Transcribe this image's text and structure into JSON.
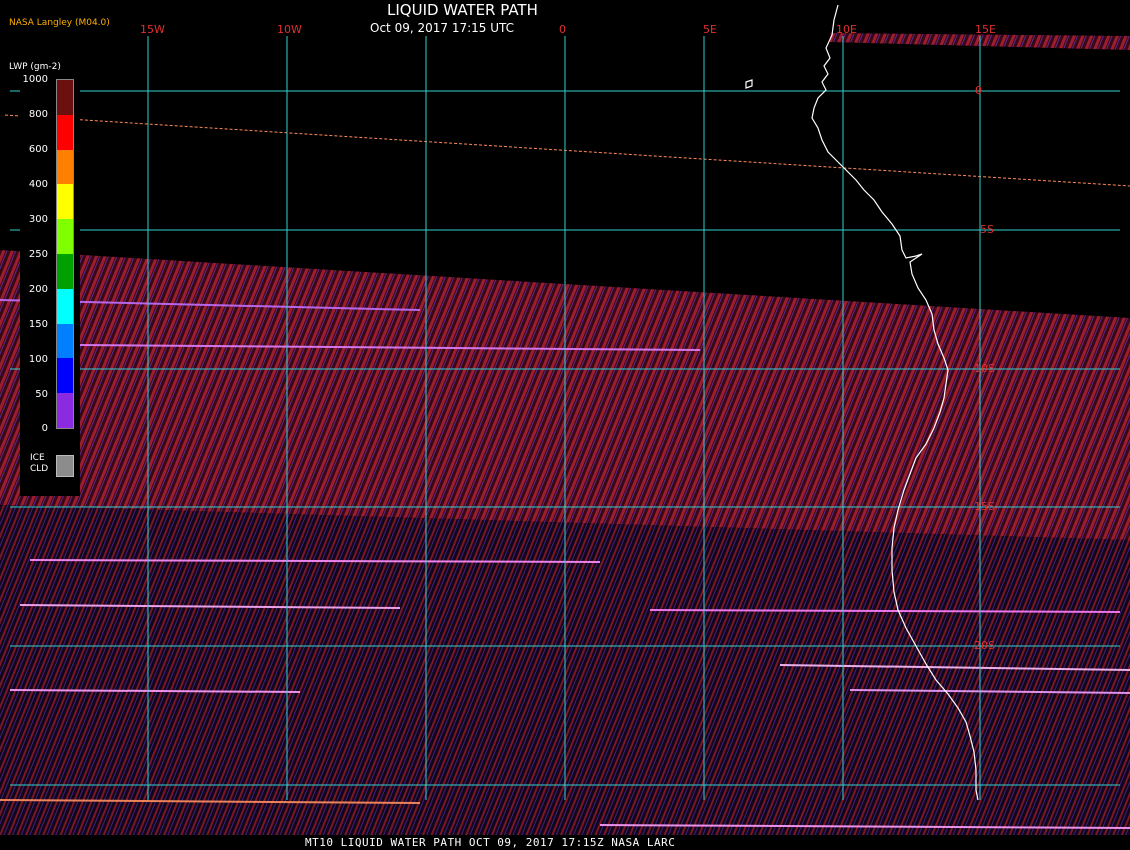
{
  "header": {
    "title": "LIQUID WATER PATH",
    "subtitle": "Oct 09, 2017 17:15 UTC",
    "source": "NASA Langley (M04.0)"
  },
  "longitude_labels": [
    "15W",
    "10W",
    "0",
    "5E",
    "10E",
    "15E"
  ],
  "latitude_labels": [
    "0",
    "5S",
    "10S",
    "15S",
    "20S"
  ],
  "legend": {
    "title": "LWP (gm-2)",
    "ticks": [
      "1000",
      "800",
      "600",
      "400",
      "300",
      "250",
      "200",
      "150",
      "100",
      "50",
      "0"
    ],
    "colors": [
      "#6b0f0f",
      "#ff0000",
      "#ff8000",
      "#ffff00",
      "#80ff00",
      "#00a000",
      "#00ffff",
      "#0080ff",
      "#0000ff",
      "#8a2be2"
    ],
    "ice_label_line1": "ICE",
    "ice_label_line2": "CLD",
    "ice_color": "#8c8c8c"
  },
  "colors": {
    "grid": "#30d0d0",
    "labels": "#e03030",
    "coast": "#ffffff",
    "swath": "#6a1424"
  },
  "footer": "MT10  LIQUID WATER PATH   OCT 09, 2017 17:15Z   NASA LARC"
}
